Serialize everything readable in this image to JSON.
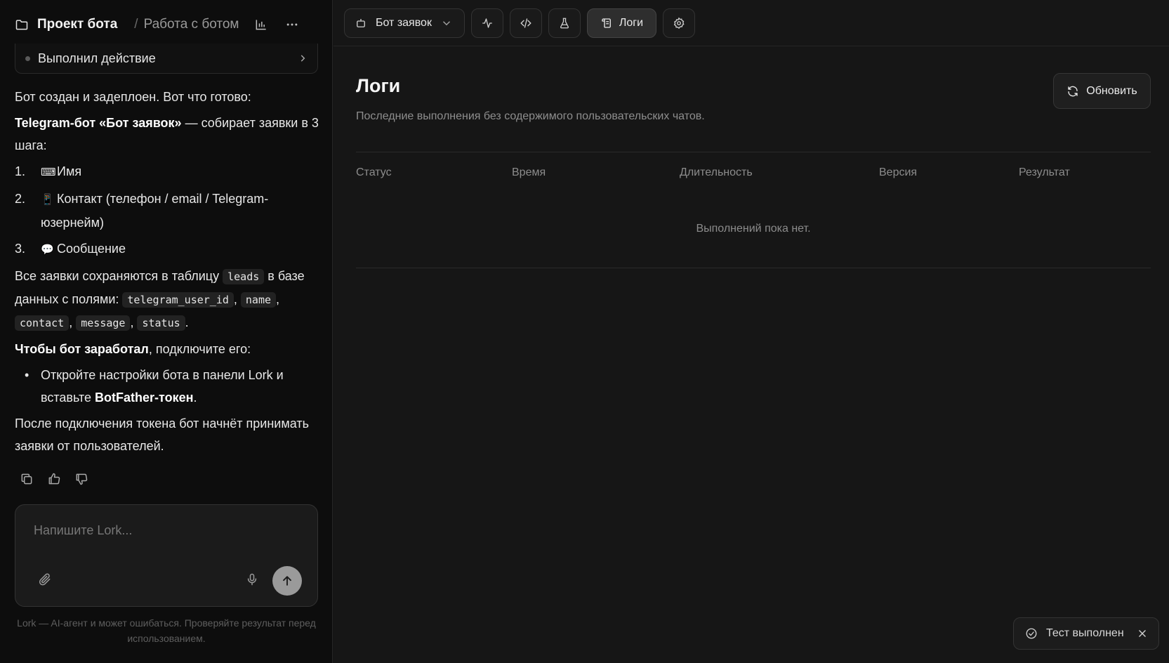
{
  "header": {
    "project_title": "Проект бота",
    "breadcrumb_sep": "/",
    "breadcrumb": "Работа с ботом"
  },
  "action_card": {
    "label": "Выполнил действие"
  },
  "message": {
    "intro": "Бот создан и задеплоен. Вот что готово:",
    "bot_bold": "Telegram-бот «Бот заявок»",
    "bot_rest": " — собирает заявки в 3 шага:",
    "steps": [
      {
        "num": "1.",
        "emoji": "⌨",
        "text": "Имя"
      },
      {
        "num": "2.",
        "emoji": "📱",
        "text": "Контакт (телефон / email / Telegram-юзернейм)"
      },
      {
        "num": "3.",
        "emoji": "💬",
        "text": "Сообщение"
      }
    ],
    "storage_pre": "Все заявки сохраняются в таблицу ",
    "storage_table": "leads",
    "storage_mid": " в базе данных с полями: ",
    "fields": [
      "telegram_user_id",
      "name",
      "contact",
      "message",
      "status"
    ],
    "connect_bold": "Чтобы бот заработал",
    "connect_rest": ", подключите его:",
    "bullet_pre": "Откройте настройки бота в панели Lork и вставьте ",
    "bullet_bold": "BotFather-токен",
    "bullet_post": ".",
    "outro": "После подключения токена бот начнёт принимать заявки от пользователей."
  },
  "composer": {
    "placeholder": "Напишите Lork..."
  },
  "disclaimer": "Lork — AI-агент и может ошибаться. Проверяйте результат перед использованием.",
  "toolbar": {
    "bot_name": "Бот заявок",
    "logs_label": "Логи"
  },
  "logs": {
    "title": "Логи",
    "subtitle": "Последние выполнения без содержимого пользовательских чатов.",
    "refresh_label": "Обновить",
    "columns": [
      "Статус",
      "Время",
      "Длительность",
      "Версия",
      "Результат"
    ],
    "empty": "Выполнений пока нет."
  },
  "toast": {
    "text": "Тест выполнен"
  }
}
